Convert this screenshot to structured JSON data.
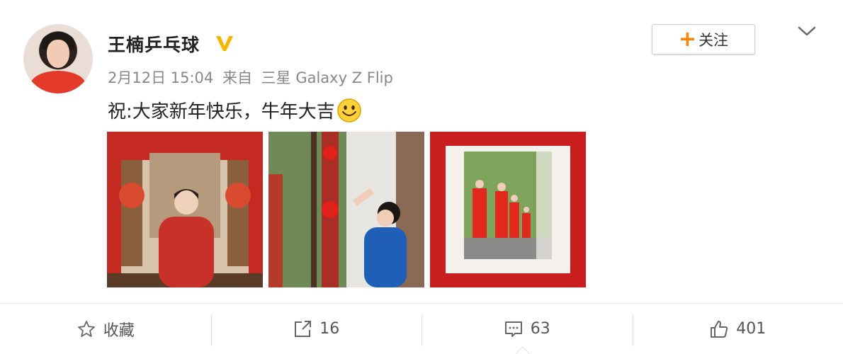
{
  "post": {
    "user_name": "王楠乒乓球",
    "date": "2月12日 15:04",
    "from_label": "来自",
    "device": "三星 Galaxy Z Flip",
    "text": "祝:大家新年快乐，牛年大吉",
    "emoji_icon": "smile-emoji-icon"
  },
  "follow_button": {
    "plus": "+",
    "label": "关注"
  },
  "photos": [
    {
      "name": "photo-1",
      "description_icon": "image"
    },
    {
      "name": "photo-2",
      "description_icon": "image"
    },
    {
      "name": "photo-3",
      "description_icon": "image"
    }
  ],
  "actions": {
    "favorite_label": "收藏",
    "repost_count": "16",
    "comment_count": "63",
    "like_count": "401"
  },
  "colors": {
    "accent_orange": "#ff8200",
    "verified_gold": "#f7b500",
    "text_meta": "#888888"
  }
}
